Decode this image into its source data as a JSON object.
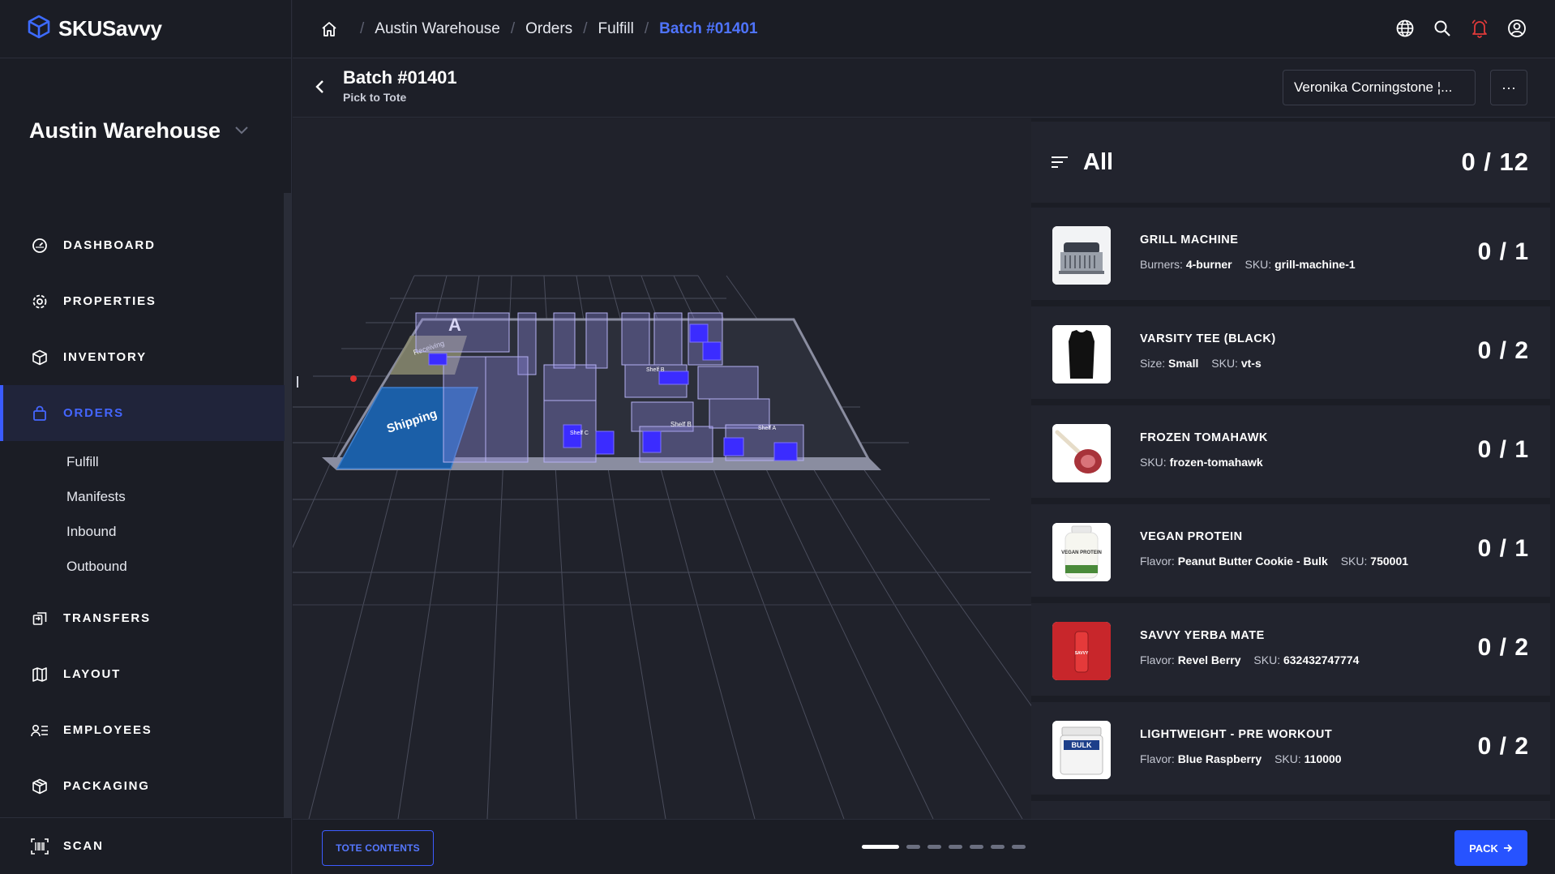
{
  "brand": {
    "name": "SKUSavvy"
  },
  "sidebar": {
    "warehouse": "Austin Warehouse",
    "items": [
      {
        "label": "DASHBOARD",
        "icon": "gauge-icon"
      },
      {
        "label": "PROPERTIES",
        "icon": "gear-icon"
      },
      {
        "label": "INVENTORY",
        "icon": "box-icon"
      },
      {
        "label": "ORDERS",
        "icon": "bag-icon"
      },
      {
        "label": "TRANSFERS",
        "icon": "transfer-icon"
      },
      {
        "label": "LAYOUT",
        "icon": "map-icon"
      },
      {
        "label": "EMPLOYEES",
        "icon": "employees-icon"
      },
      {
        "label": "PACKAGING",
        "icon": "package-icon"
      }
    ],
    "orders_sub": [
      "Fulfill",
      "Manifests",
      "Inbound",
      "Outbound"
    ],
    "scan": "SCAN"
  },
  "breadcrumb": [
    "Austin Warehouse",
    "Orders",
    "Fulfill",
    "Batch #01401"
  ],
  "header": {
    "title": "Batch #01401",
    "subtitle": "Pick to Tote",
    "assignee": "Veronika Corningstone ¦...",
    "more": "···"
  },
  "map": {
    "receiving_label": "Receiving",
    "shipping_label": "Shipping",
    "aisle_label": "A",
    "shelf_labels": [
      "Shelf C",
      "Shelf B",
      "Shelf B",
      "Shelf A"
    ]
  },
  "summary": {
    "label": "All",
    "count": "0 / 12"
  },
  "items": [
    {
      "name": "GRILL MACHINE",
      "attrs": [
        [
          "Burners:",
          "4-burner"
        ],
        [
          "SKU:",
          "grill-machine-1"
        ]
      ],
      "count": "0 / 1"
    },
    {
      "name": "VARSITY TEE (BLACK)",
      "attrs": [
        [
          "Size:",
          "Small"
        ],
        [
          "SKU:",
          "vt-s"
        ]
      ],
      "count": "0 / 2"
    },
    {
      "name": "FROZEN TOMAHAWK",
      "attrs": [
        [
          "SKU:",
          "frozen-tomahawk"
        ]
      ],
      "count": "0 / 1"
    },
    {
      "name": "VEGAN PROTEIN",
      "attrs": [
        [
          "Flavor:",
          "Peanut Butter Cookie - Bulk"
        ],
        [
          "SKU:",
          "750001"
        ]
      ],
      "count": "0 / 1"
    },
    {
      "name": "SAVVY YERBA MATE",
      "attrs": [
        [
          "Flavor:",
          "Revel Berry"
        ],
        [
          "SKU:",
          "632432747774"
        ]
      ],
      "count": "0 / 2"
    },
    {
      "name": "LIGHTWEIGHT - PRE WORKOUT",
      "attrs": [
        [
          "Flavor:",
          "Blue Raspberry"
        ],
        [
          "SKU:",
          "110000"
        ]
      ],
      "count": "0 / 2"
    }
  ],
  "thumb_text": {
    "protein": "VEGAN PROTEIN",
    "mate": "SAVVY",
    "bulk": "BULK"
  },
  "footer": {
    "tote": "TOTE CONTENTS",
    "pack": "PACK",
    "pages": 7,
    "active_page": 0
  },
  "colors": {
    "accent": "#2753ff",
    "active_nav": "#4466ff",
    "shelf": "#8c86e0",
    "pick": "#3b2cff",
    "shipping": "#1b5fa8"
  }
}
